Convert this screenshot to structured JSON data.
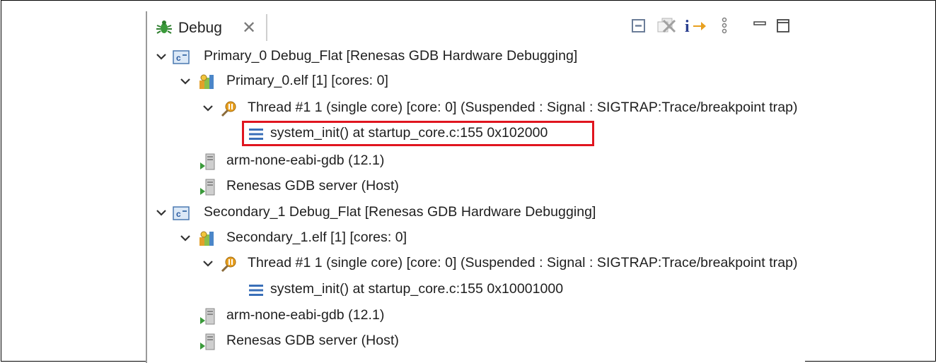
{
  "view": {
    "tab_label": "Debug",
    "tab_icon": "debug-bug-icon",
    "close_icon": "close-icon",
    "toolbar_icons": [
      "collapse-all-icon",
      "remove-terminated-icon",
      "step-into-instruction-icon",
      "view-menu-icon",
      "minimize-icon",
      "maximize-icon"
    ]
  },
  "tree": {
    "launch1": {
      "label": "Primary_0 Debug_Flat [Renesas GDB Hardware Debugging]",
      "icon": "c-launch-icon"
    },
    "process1": {
      "label": "Primary_0.elf [1] [cores: 0]",
      "icon": "process-icon"
    },
    "thread1": {
      "label": "Thread #1 1 (single core) [core: 0] (Suspended : Signal : SIGTRAP:Trace/breakpoint trap)",
      "icon": "thread-suspended-icon"
    },
    "frame1": {
      "label": "system_init() at startup_core.c:155 0x102000",
      "icon": "stack-frame-icon"
    },
    "gdb1": {
      "label": "arm-none-eabi-gdb (12.1)",
      "icon": "gdb-process-icon"
    },
    "server1": {
      "label": "Renesas GDB server (Host)",
      "icon": "gdb-server-icon"
    },
    "launch2": {
      "label": "Secondary_1 Debug_Flat [Renesas GDB Hardware Debugging]",
      "icon": "c-launch-icon"
    },
    "process2": {
      "label": "Secondary_1.elf [1] [cores: 0]",
      "icon": "process-icon"
    },
    "thread2": {
      "label": "Thread #1 1 (single core) [core: 0] (Suspended : Signal : SIGTRAP:Trace/breakpoint trap)",
      "icon": "thread-suspended-icon"
    },
    "frame2": {
      "label": "system_init() at startup_core.c:155 0x10001000",
      "icon": "stack-frame-icon"
    },
    "gdb2": {
      "label": "arm-none-eabi-gdb (12.1)",
      "icon": "gdb-process-icon"
    },
    "server2": {
      "label": "Renesas GDB server (Host)",
      "icon": "gdb-server-icon"
    }
  },
  "highlight_color": "#e0151f"
}
